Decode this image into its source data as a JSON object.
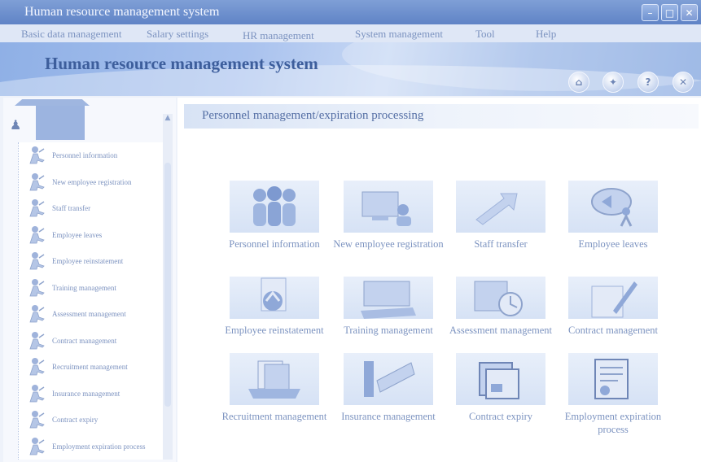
{
  "window": {
    "title": "Human resource management system",
    "controls": [
      "minimize-icon",
      "maximize-icon",
      "close-icon"
    ]
  },
  "menubar": {
    "items": [
      "Basic data management",
      "Salary settings",
      "HR management",
      "System management",
      "Tool",
      "Help"
    ]
  },
  "banner": {
    "title": "Human resource management system",
    "buttons": [
      "home-icon",
      "navigation-icon",
      "help-icon",
      "exit-icon"
    ]
  },
  "sidebar": {
    "items": [
      {
        "label": "Personnel information"
      },
      {
        "label": "New employee registration"
      },
      {
        "label": "Staff transfer"
      },
      {
        "label": "Employee leaves"
      },
      {
        "label": "Employee reinstatement"
      },
      {
        "label": "Training management"
      },
      {
        "label": "Assessment management"
      },
      {
        "label": "Contract management"
      },
      {
        "label": "Recruitment management"
      },
      {
        "label": "Insurance management"
      },
      {
        "label": "Contract expiry"
      },
      {
        "label": "Employment expiration process"
      }
    ]
  },
  "main": {
    "header": "Personnel management/expiration processing",
    "tiles": [
      {
        "label": "Personnel information",
        "icon": "people-group-icon"
      },
      {
        "label": "New employee registration",
        "icon": "computer-registration-icon"
      },
      {
        "label": "Staff transfer",
        "icon": "transfer-arrow-icon"
      },
      {
        "label": "Employee leaves",
        "icon": "leave-person-icon"
      },
      {
        "label": "Employee reinstatement",
        "icon": "reinstatement-icon"
      },
      {
        "label": "Training management",
        "icon": "training-keyboard-icon"
      },
      {
        "label": "Assessment management",
        "icon": "assessment-clock-icon"
      },
      {
        "label": "Contract management",
        "icon": "contract-pen-icon"
      },
      {
        "label": "Recruitment management",
        "icon": "recruitment-files-icon"
      },
      {
        "label": "Insurance management",
        "icon": "insurance-icon"
      },
      {
        "label": "Contract expiry",
        "icon": "contract-expiry-folder-icon"
      },
      {
        "label": "Employment expiration process",
        "icon": "expiration-document-icon"
      }
    ]
  },
  "colors": {
    "titlebar": "#6f92d0",
    "banner": "#9ab7e7",
    "text": "#7c93c0",
    "accent": "#5b74a8"
  }
}
